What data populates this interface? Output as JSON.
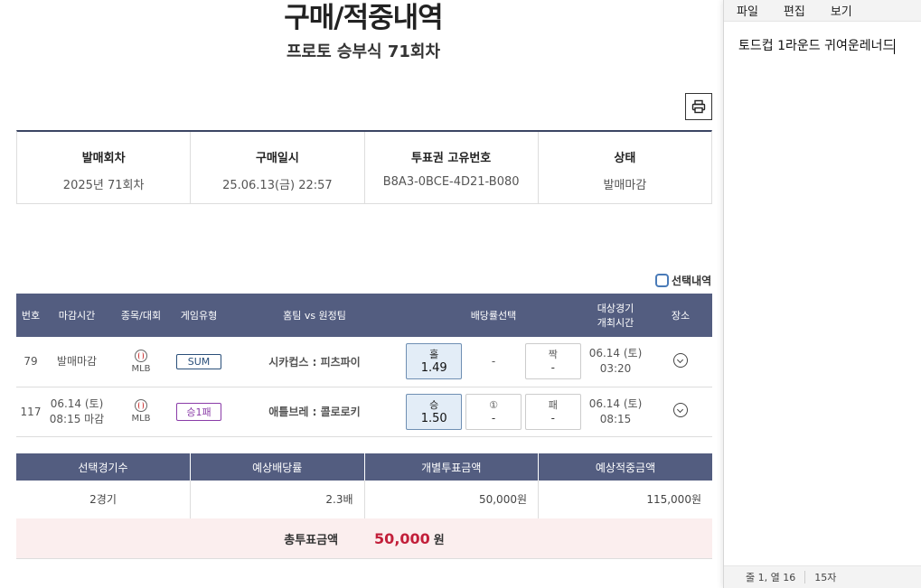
{
  "header": {
    "title": "구매/적중내역",
    "subtitle": "프로토 승부식 71회차",
    "print_icon": "printer-icon"
  },
  "info": [
    {
      "label": "발매회차",
      "value": "2025년 71회차"
    },
    {
      "label": "구매일시",
      "value": "25.06.13(금) 22:57"
    },
    {
      "label": "투표권 고유번호",
      "value": "B8A3-0BCE-4D21-B080"
    },
    {
      "label": "상태",
      "value": "발매마감"
    }
  ],
  "selection_toggle": {
    "label": "선택내역"
  },
  "games_table": {
    "headers": {
      "no": "번호",
      "deadline": "마감시간",
      "sport": "종목/대회",
      "type": "게임유형",
      "teams": "홈팀 vs 원정팀",
      "odds": "배당률선택",
      "match_time_1": "대상경기",
      "match_time_2": "개최시간",
      "venue": "장소"
    },
    "rows": [
      {
        "no": "79",
        "deadline_1": "발매마감",
        "deadline_2": "",
        "sport": "MLB",
        "type": "SUM",
        "teams": "시카컵스 : 피츠파이",
        "odd1_label": "홀",
        "odd1_value": "1.49",
        "odd2_label": "-",
        "odd2_value": "",
        "odd3_label": "짝",
        "odd3_value": "-",
        "date": "06.14 (토)",
        "time": "03:20"
      },
      {
        "no": "117",
        "deadline_1": "06.14 (토)",
        "deadline_2": "08:15 마감",
        "sport": "MLB",
        "type": "승1패",
        "teams": "애틀브레 : 콜로로키",
        "odd1_label": "승",
        "odd1_value": "1.50",
        "odd2_label": "①",
        "odd2_value": "-",
        "odd3_label": "패",
        "odd3_value": "-",
        "date": "06.14 (토)",
        "time": "08:15"
      }
    ]
  },
  "summary": {
    "headers": [
      "선택경기수",
      "예상배당률",
      "개별투표금액",
      "예상적중금액"
    ],
    "values": [
      "2경기",
      "2.3배",
      "50,000원",
      "115,000원"
    ]
  },
  "total": {
    "label": "총투표금액",
    "amount": "50,000",
    "unit": "원"
  },
  "notepad": {
    "menu": [
      "파일",
      "편집",
      "보기"
    ],
    "text": "토드컵 1라운드 귀여운레너드",
    "status_pos": "줄 1, 열 16",
    "status_count": "15자"
  },
  "colors": {
    "header_bg": "#535d80",
    "total_amount": "#c21f3a",
    "selected_odds": "#e3edf7"
  }
}
